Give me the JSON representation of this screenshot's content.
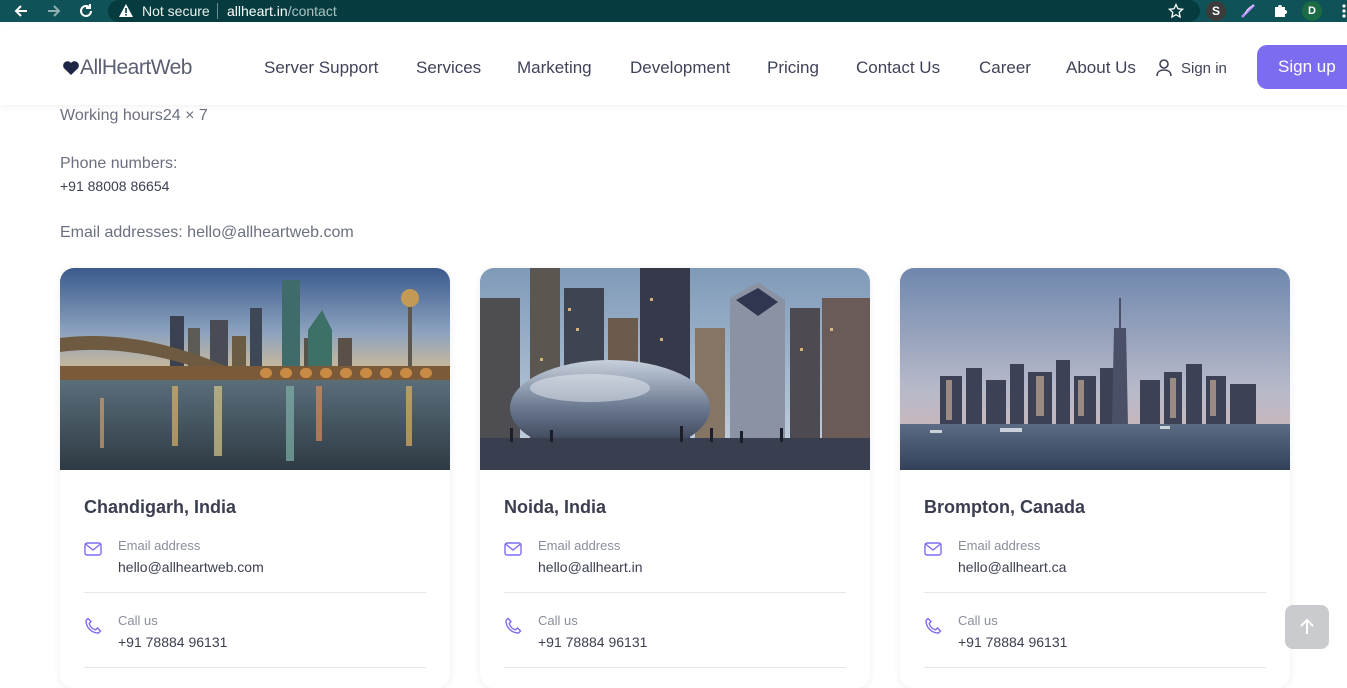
{
  "browser": {
    "security_label": "Not secure",
    "url_host": "allheart.in",
    "url_path": "/contact",
    "ext_s": "S",
    "ext_d": "D"
  },
  "header": {
    "logo_text": "AllHeartWeb",
    "nav": [
      "Server Support",
      "Services",
      "Marketing",
      "Development",
      "Pricing",
      "Contact Us",
      "Career",
      "About Us"
    ],
    "signin_label": "Sign in",
    "signup_label": "Sign up"
  },
  "contact": {
    "working_hours": "Working hours24 × 7",
    "phone_heading": "Phone numbers:",
    "phone_value": "+91 88008 86654",
    "email_line": "Email addresses: hello@allheartweb.com"
  },
  "cards": [
    {
      "city": "Chandigarh, India",
      "email_label": "Email address",
      "email": "hello@allheartweb.com",
      "call_label": "Call us",
      "phone": "+91 78884 96131"
    },
    {
      "city": "Noida, India",
      "email_label": "Email address",
      "email": "hello@allheart.in",
      "call_label": "Call us",
      "phone": "+91 78884 96131"
    },
    {
      "city": "Brompton, Canada",
      "email_label": "Email address",
      "email": "hello@allheart.ca",
      "call_label": "Call us",
      "phone": "+91 78884 96131"
    }
  ],
  "colors": {
    "accent": "#7c6df0",
    "browser_bar": "#0f5257"
  }
}
